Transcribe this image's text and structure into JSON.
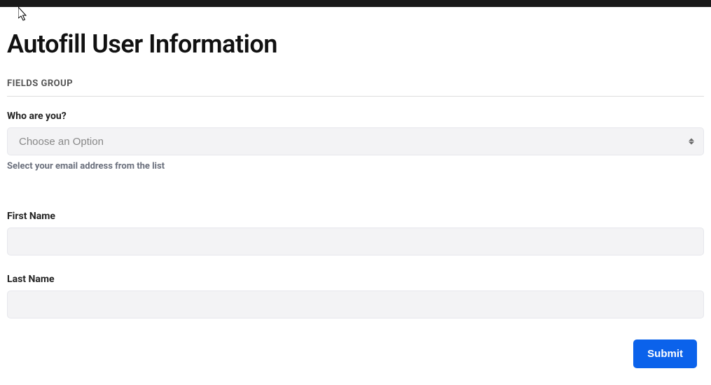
{
  "page": {
    "title": "Autofill User Information"
  },
  "section": {
    "header": "FIELDS GROUP"
  },
  "who": {
    "label": "Who are you?",
    "placeholder": "Choose an Option",
    "help": "Select your email address from the list"
  },
  "first_name": {
    "label": "First Name",
    "value": ""
  },
  "last_name": {
    "label": "Last Name",
    "value": ""
  },
  "actions": {
    "submit": "Submit"
  }
}
